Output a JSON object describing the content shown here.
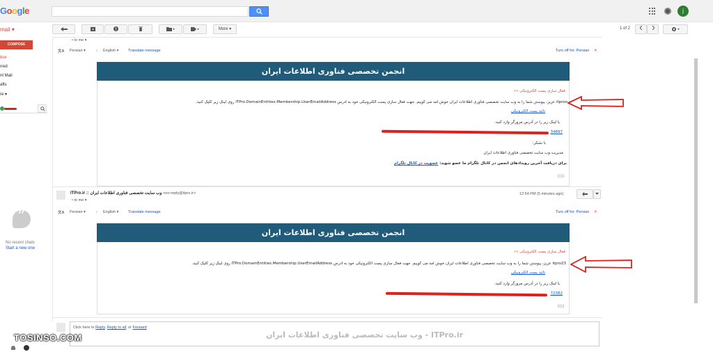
{
  "header": {
    "logo_letters": [
      "G",
      "o",
      "o",
      "g",
      "l",
      "e"
    ],
    "search_value": "",
    "avatar_letter": "j",
    "apps_icon": "apps-grid-icon",
    "notifications_icon": "notifications-icon"
  },
  "toolbar": {
    "mail_label": "mail ▾",
    "more_label": "More ▾",
    "pager": "1 of 2",
    "settings_icon": "gear-icon"
  },
  "sidebar": {
    "compose": "COMPOSE",
    "items": [
      {
        "label": "box",
        "active": true
      },
      {
        "label": "rred"
      },
      {
        "label": "nt Mail"
      },
      {
        "label": "afts"
      },
      {
        "label": "re ▾"
      }
    ],
    "no_chats": "No recent chats",
    "start_chat": "Start a new one"
  },
  "messages": [
    {
      "to_me": "to me ▾",
      "translate": {
        "from": "Persian ▾",
        "arrow": "›",
        "to": "English ▾",
        "action": "Translate message",
        "turn_off": "Turn off for: Persian"
      },
      "banner": "انجمن تخصصی فناوری اطلاعات ایران",
      "activation_title": "فعال سازی پست الکترونیکی »»",
      "body_line": "itproo عزیز، پیوستن شما را به وب سایت تخصصی فناوری اطلاعات ایران خوش آمد می گوییم. جهت فعال سازی پست الکترونیکی خود به آدرس ITPro.DomainEntities.Membership.UserEmailAddress روی لینک زیر کلیک کنید.",
      "confirm_link": "تائید پست الکترونیکی",
      "copy_line": "یا لینک زیر را در آدرس مرورگر وارد کنید:",
      "url_tail": "34897",
      "thanks": "با تشکر:",
      "signature": "مدیریت وب سایت تخصصی فناوری اطلاعات ایران",
      "telegram_text": "برای دریافت آخرین رویدادهای انجمن در کانال تلگرام ما عضو شوید:",
      "telegram_link": "عضویت در کانال تلگرام"
    },
    {
      "sender": "ITPro.ir :: وب سایت تخصصی فناوری اطلاعات ایران",
      "sender_email": "<no-reply@itpro.ir>",
      "time": "12:54 PM (5 minutes ago)",
      "to_me": "to me ▾",
      "translate": {
        "from": "Persian ▾",
        "arrow": "›",
        "to": "English ▾",
        "action": "Translate message",
        "turn_off": "Turn off for: Persian"
      },
      "banner": "انجمن تخصصی فناوری اطلاعات ایران",
      "activation_title": "فعال سازی پست الکترونیکی »»",
      "body_line": "itpro23 عزیز، پیوستن شما را به وب سایت تخصصی فناوری اطلاعات ایران خوش آمد می گوییم. جهت فعال سازی پست الکترونیکی خود به آدرس ITPro.DomainEntities.Membership.UserEmailAddress روی لینک زیر کلیک کنید.",
      "confirm_link": "تائید پست الکترونیکی",
      "copy_line": "یا لینک زیر را در آدرس مرورگر وارد کنید:",
      "url_tail": "72382"
    }
  ],
  "reply": {
    "prefix": "Click here to",
    "reply": "Reply",
    "reply_all": "Reply to all",
    "or": ", or",
    "forward": "Forward"
  },
  "overlays": {
    "watermark": "ITPro.ir - وب سایت تخصصی فناوری اطلاعات ایران",
    "tosinso": "TOSINSO.COM",
    "arrow_color": "#e0201a"
  },
  "colors": {
    "banner": "#205b7a",
    "accent_red": "#d14836",
    "search_blue": "#4d90fe"
  }
}
